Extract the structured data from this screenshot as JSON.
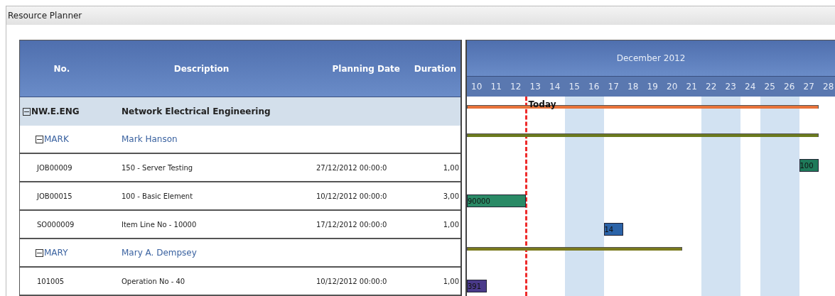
{
  "window": {
    "title": "Resource Planner"
  },
  "columns": [
    "No.",
    "Description",
    "Planning Date",
    "Duration"
  ],
  "rows": [
    {
      "kind": "group",
      "expanded": true,
      "no": "NW.E.ENG",
      "description": "Network Electrical Engineering",
      "bar": {
        "kind": "summary",
        "color": "#e8733a",
        "level": 0.947
      }
    },
    {
      "kind": "resource",
      "expanded": true,
      "no": "MARK",
      "description": "Mark Hanson",
      "bar": {
        "kind": "summary",
        "color": "#6b7a1e",
        "level": 0.947
      }
    },
    {
      "kind": "task",
      "no": "JOB00009",
      "description": "150 - Server Testing",
      "date": "27/12/2012 00:00:0",
      "duration": "1,00",
      "bar": {
        "kind": "task",
        "color": "#1f7a5a",
        "label": "100"
      }
    },
    {
      "kind": "task",
      "no": "JOB00015",
      "description": "100 - Basic Element",
      "date": "10/12/2012 00:00:0",
      "duration": "3,00",
      "bar": {
        "kind": "task",
        "color": "#2a8a66",
        "label": "90000"
      }
    },
    {
      "kind": "task",
      "no": "SO000009",
      "description": "Item Line No - 10000",
      "date": "17/12/2012 00:00:0",
      "duration": "1,00",
      "bar": {
        "kind": "task",
        "color": "#2b63a8",
        "label": "14"
      }
    },
    {
      "kind": "resource",
      "expanded": true,
      "no": "MARY",
      "description": "Mary A. Dempsey",
      "bar": {
        "kind": "summary",
        "color": "#7a7a1e",
        "level": 0.579
      }
    },
    {
      "kind": "task",
      "no": "101005",
      "description": "Operation No - 40",
      "date": "10/12/2012 00:00:0",
      "duration": "1,00",
      "bar": {
        "kind": "task",
        "color": "#4a3a8a",
        "label": "391"
      }
    }
  ],
  "gantt": {
    "month": "December 2012",
    "today_label": "Today",
    "days": [
      {
        "label": "10",
        "weekend": false,
        "today": false
      },
      {
        "label": "11",
        "weekend": false,
        "today": false
      },
      {
        "label": "12",
        "weekend": false,
        "today": true
      },
      {
        "label": "13",
        "weekend": false,
        "today": false
      },
      {
        "label": "14",
        "weekend": false,
        "today": false
      },
      {
        "label": "15",
        "weekend": true,
        "today": false
      },
      {
        "label": "16",
        "weekend": true,
        "today": false
      },
      {
        "label": "17",
        "weekend": false,
        "today": false
      },
      {
        "label": "18",
        "weekend": false,
        "today": false
      },
      {
        "label": "19",
        "weekend": false,
        "today": false
      },
      {
        "label": "20",
        "weekend": false,
        "today": false
      },
      {
        "label": "21",
        "weekend": false,
        "today": false
      },
      {
        "label": "22",
        "weekend": true,
        "today": false
      },
      {
        "label": "23",
        "weekend": true,
        "today": false
      },
      {
        "label": "24",
        "weekend": false,
        "today": false
      },
      {
        "label": "25",
        "weekend": true,
        "today": false
      },
      {
        "label": "26",
        "weekend": true,
        "today": false
      },
      {
        "label": "27",
        "weekend": false,
        "today": false
      },
      {
        "label": "28",
        "weekend": false,
        "today": false
      }
    ]
  }
}
